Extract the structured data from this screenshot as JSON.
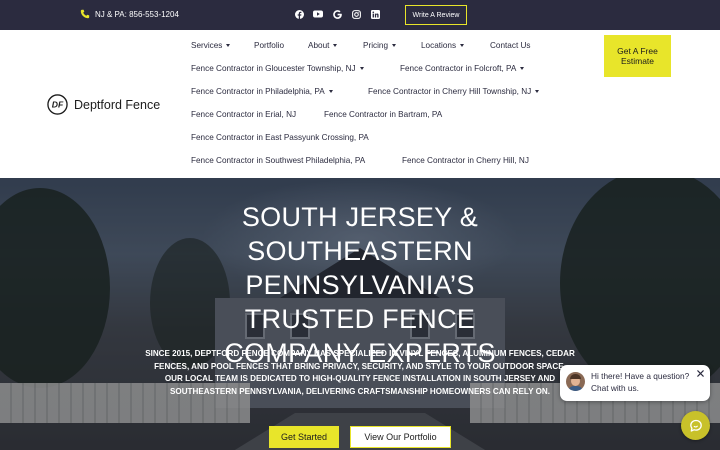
{
  "topbar": {
    "phone_text": "NJ & PA: 856-553-1204",
    "socials": [
      "facebook-icon",
      "youtube-icon",
      "google-icon",
      "instagram-icon",
      "linkedin-icon"
    ],
    "review_button": "Write A Review"
  },
  "brand": {
    "logo_mark": "DF",
    "name": "Deptford Fence"
  },
  "nav": {
    "services": "Services",
    "portfolio": "Portfolio",
    "about": "About",
    "pricing": "Pricing",
    "locations": "Locations",
    "contact": "Contact Us",
    "gloucester": "Fence Contractor in Gloucester Township, NJ",
    "folcroft": "Fence Contractor in Folcroft, PA",
    "philadelphia": "Fence Contractor in Philadelphia, PA",
    "cherry_hill_township": "Fence Contractor in Cherry Hill Township, NJ",
    "erial": "Fence Contractor in Erial, NJ",
    "bartram": "Fence Contractor in Bartram, PA",
    "east_passyunk": "Fence Contractor in East Passyunk Crossing, PA",
    "sw_philadelphia": "Fence Contractor in Southwest Philadelphia, PA",
    "cherry_hill": "Fence Contractor in Cherry Hill, NJ"
  },
  "quote_button": "Get A Free Estimate",
  "hero": {
    "title": "SOUTH JERSEY & SOUTHEASTERN PENNSYLVANIA’S TRUSTED FENCE COMPANY EXPERTS",
    "description": "SINCE 2015, DEPTFORD FENCE COMPANY HAS SPECIALIZED IN VINYL FENCES, ALUMINUM FENCES, CEDAR FENCES, AND POOL FENCES THAT BRING PRIVACY, SECURITY, AND STYLE TO YOUR OUTDOOR SPACE. OUR LOCAL TEAM IS DEDICATED TO HIGH-QUALITY FENCE INSTALLATION IN SOUTH JERSEY AND SOUTHEASTERN PENNSYLVANIA, DELIVERING CRAFTSMANSHIP HOMEOWNERS CAN RELY ON.",
    "cta_primary": "Get Started",
    "cta_secondary": "View Our Portfolio"
  },
  "chat": {
    "message": "Hi there! Have a question? Chat with us."
  },
  "colors": {
    "accent": "#e8e52a",
    "topbar": "#2b2b3f",
    "text": "#2b2b3f"
  }
}
